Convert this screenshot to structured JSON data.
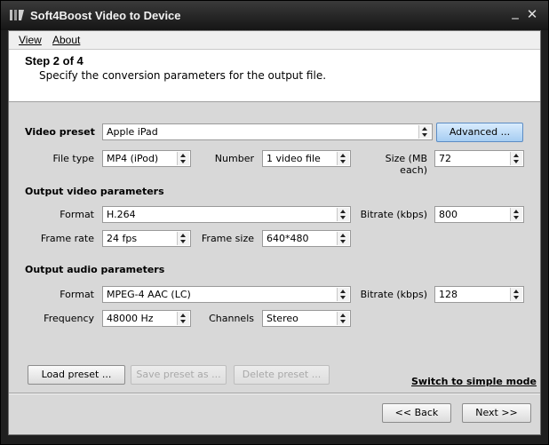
{
  "window": {
    "title": "Soft4Boost Video to Device",
    "minimize_glyph": "_",
    "close_glyph": "✕",
    "icon": "app-logo-icon"
  },
  "menu": {
    "view": "View",
    "about": "About"
  },
  "header": {
    "step": "Step 2 of 4",
    "description": "Specify the conversion parameters for the output file."
  },
  "video_preset": {
    "label": "Video preset",
    "value": "Apple iPad",
    "advanced_button": "Advanced ...",
    "file_type_label": "File type",
    "file_type_value": "MP4 (iPod)",
    "number_label": "Number",
    "number_value": "1 video file",
    "size_label": "Size (MB each)",
    "size_value": "72"
  },
  "video_params": {
    "section": "Output video parameters",
    "format_label": "Format",
    "format_value": "H.264",
    "bitrate_label": "Bitrate (kbps)",
    "bitrate_value": "800",
    "frame_rate_label": "Frame rate",
    "frame_rate_value": "24 fps",
    "frame_size_label": "Frame size",
    "frame_size_value": "640*480"
  },
  "audio_params": {
    "section": "Output audio parameters",
    "format_label": "Format",
    "format_value": "MPEG-4 AAC (LC)",
    "bitrate_label": "Bitrate (kbps)",
    "bitrate_value": "128",
    "frequency_label": "Frequency",
    "frequency_value": "48000 Hz",
    "channels_label": "Channels",
    "channels_value": "Stereo"
  },
  "presets": {
    "load": "Load preset ...",
    "save": "Save preset as ...",
    "delete": "Delete preset ..."
  },
  "simple_mode_link": "Switch to simple mode",
  "nav": {
    "back": "<< Back",
    "next": "Next >>"
  },
  "colors": {
    "titlebar": "#1f1f1f",
    "client_bg": "#d8d8d8",
    "advanced_button": "#a6cdf2"
  }
}
